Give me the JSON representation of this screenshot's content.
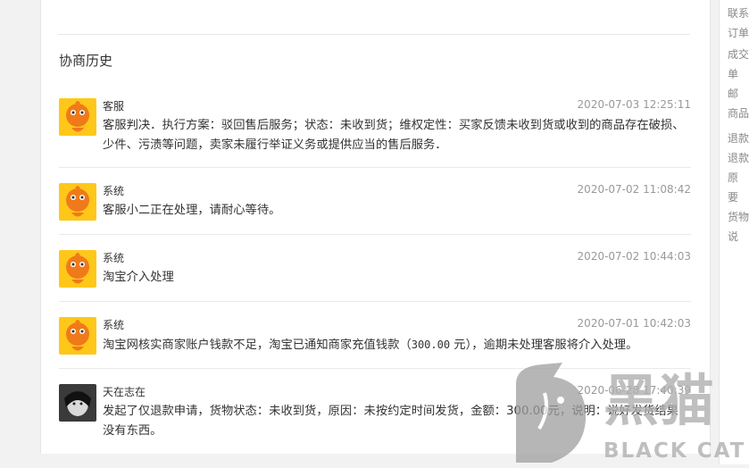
{
  "history": {
    "title": "协商历史",
    "entries": [
      {
        "author": "客服",
        "time": "2020-07-03 12:25:11",
        "message": "客服判决．执行方案：驳回售后服务；状态：未收到货；维权定性：买家反馈未收到货或收到的商品存在破损、少件、污渍等问题，卖家未履行举证义务或提供应当的售后服务．",
        "avatar": "taobao-mascot"
      },
      {
        "author": "系统",
        "time": "2020-07-02 11:08:42",
        "message": "客服小二正在处理，请耐心等待。",
        "avatar": "taobao-mascot"
      },
      {
        "author": "系统",
        "time": "2020-07-02 10:44:03",
        "message": "淘宝介入处理",
        "avatar": "taobao-mascot"
      },
      {
        "author": "系统",
        "time": "2020-07-01 10:42:03",
        "message_before": "淘宝网核实商家账户钱款不足，淘宝已通知商家充值钱款（",
        "message_amount": "300.00",
        "message_after": " 元），逾期未处理客服将介入处理。",
        "avatar": "taobao-mascot"
      },
      {
        "author": "天在志在",
        "time": "2020-06-28 17:40:39",
        "message": "发起了仅退款申请，货物状态：未收到货，原因：未按约定时间发货，金额：300.00元，说明：说好发货结果没有东西。",
        "avatar": "user-photo"
      }
    ]
  },
  "right_column": [
    "联系",
    "订单",
    "成交",
    "单",
    "邮",
    "商品",
    "退款",
    "退款",
    "原",
    "要",
    "货物",
    "说"
  ],
  "watermark": {
    "text_cn": "黑猫",
    "text_en": "BLACK CAT",
    "color": "#b3b3b3"
  },
  "colors": {
    "mascot_orange": "#f07a1a",
    "mascot_yellow": "#ffc71a"
  }
}
